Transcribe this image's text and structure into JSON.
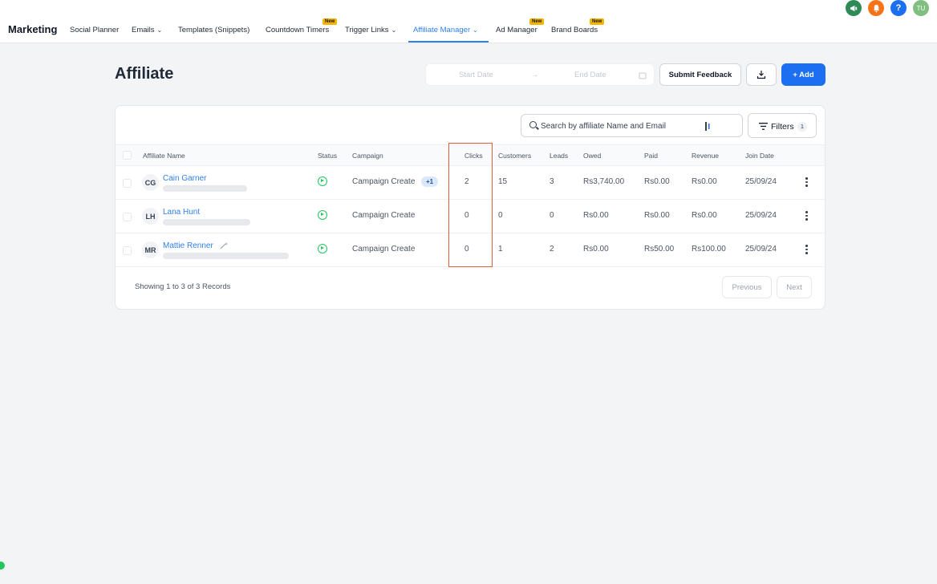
{
  "nav": {
    "brand": "Marketing",
    "items": [
      {
        "label": "Social Planner",
        "chevron": false
      },
      {
        "label": "Emails",
        "chevron": true
      },
      {
        "label": "Templates (Snippets)",
        "chevron": false
      },
      {
        "label": "Countdown Timers",
        "chevron": false,
        "badge": "New"
      },
      {
        "label": "Trigger Links",
        "chevron": true
      },
      {
        "label": "Affiliate Manager",
        "chevron": true,
        "active": true
      },
      {
        "label": "Ad Manager",
        "chevron": false,
        "badge": "New"
      },
      {
        "label": "Brand Boards",
        "chevron": false,
        "badge": "New"
      }
    ],
    "new_badge": "New",
    "chevron_glyph": "⌄"
  },
  "top_icons": [
    {
      "name": "megaphone-icon",
      "color": "#2e8b57",
      "glyph": "📢"
    },
    {
      "name": "bell-icon",
      "color": "#f97316",
      "glyph": "🔔"
    },
    {
      "name": "help-icon",
      "color": "#1d6ff2",
      "glyph": "?"
    },
    {
      "name": "user-avatar",
      "color": "#7fbf7f",
      "glyph": "TU"
    }
  ],
  "header": {
    "title": "Affiliate",
    "start_date_placeholder": "Start Date",
    "arrow": "→",
    "end_date_placeholder": "End Date",
    "submit_feedback": "Submit Feedback",
    "add_label": "+ Add"
  },
  "toolbar": {
    "search_placeholder": "Search by affiliate Name and Email",
    "filters_label": "Filters",
    "filters_count": "1"
  },
  "table": {
    "columns": [
      "Affiliate Name",
      "Status",
      "Campaign",
      "Clicks",
      "Customers",
      "Leads",
      "Owed",
      "Paid",
      "Revenue",
      "Join Date"
    ],
    "rows": [
      {
        "initials": "CG",
        "name": "Cain Garner",
        "campaign": "Campaign Create",
        "extra": "+1",
        "clicks": "2",
        "customers": "15",
        "leads": "3",
        "owed": "Rs3,740.00",
        "paid": "Rs0.00",
        "revenue": "Rs0.00",
        "join_date": "25/09/24"
      },
      {
        "initials": "LH",
        "name": "Lana Hunt",
        "campaign": "Campaign Create",
        "extra": "",
        "clicks": "0",
        "customers": "0",
        "leads": "0",
        "owed": "Rs0.00",
        "paid": "Rs0.00",
        "revenue": "Rs0.00",
        "join_date": "25/09/24"
      },
      {
        "initials": "MR",
        "name": "Mattie Renner",
        "campaign": "Campaign Create",
        "extra": "",
        "clicks": "0",
        "customers": "1",
        "leads": "2",
        "owed": "Rs0.00",
        "paid": "Rs50.00",
        "revenue": "Rs100.00",
        "join_date": "25/09/24"
      }
    ]
  },
  "footer": {
    "showing": "Showing 1 to 3 of 3 Records",
    "previous": "Previous",
    "next": "Next"
  },
  "colors": {
    "accent": "#2f80ed",
    "primary_button": "#1d6ff2",
    "status_active": "#22c55e",
    "highlight_box": "#e55a3a",
    "new_badge": "#f5b400"
  }
}
